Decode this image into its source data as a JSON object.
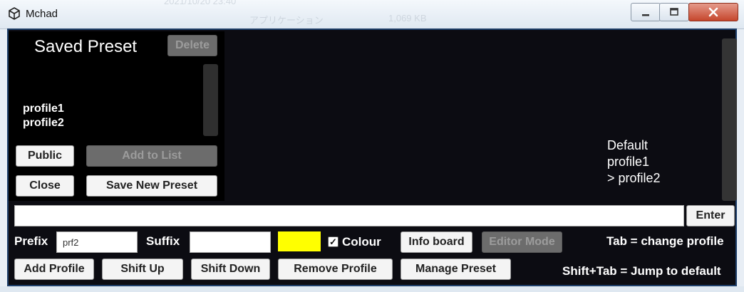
{
  "window": {
    "title": "Mchad",
    "icon": "unity-logo-icon",
    "controls": {
      "minimize": "minimize-icon",
      "maximize": "maximize-icon",
      "close": "close-icon"
    },
    "background_text": [
      "2021/10/20 23:40",
      "アプリケーション",
      "1,069 KB"
    ]
  },
  "saved_preset": {
    "title": "Saved Preset",
    "delete_label": "Delete",
    "profiles": [
      "profile1",
      "profile2"
    ],
    "public_label": "Public",
    "add_to_list_label": "Add to List",
    "close_label": "Close",
    "save_new_label": "Save New Preset"
  },
  "profile_list": [
    "Default",
    "profile1",
    "> profile2"
  ],
  "input": {
    "value": "",
    "enter_label": "Enter"
  },
  "controls": {
    "prefix_label": "Prefix",
    "prefix_value": "prf2",
    "suffix_label": "Suffix",
    "suffix_value": "",
    "colour_swatch": "#ffff00",
    "colour_label": "Colour",
    "colour_checked": true,
    "info_board_label": "Info board",
    "editor_mode_label": "Editor Mode",
    "add_profile_label": "Add Profile",
    "shift_up_label": "Shift Up",
    "shift_down_label": "Shift Down",
    "remove_profile_label": "Remove Profile",
    "manage_preset_label": "Manage Preset"
  },
  "hints": {
    "tab": "Tab = change profile",
    "shift_tab": "Shift+Tab = Jump to default"
  },
  "colors": {
    "accent_yellow": "#ffff00",
    "frame_blue": "#1e3f6a",
    "panel_bg": "#000000"
  }
}
